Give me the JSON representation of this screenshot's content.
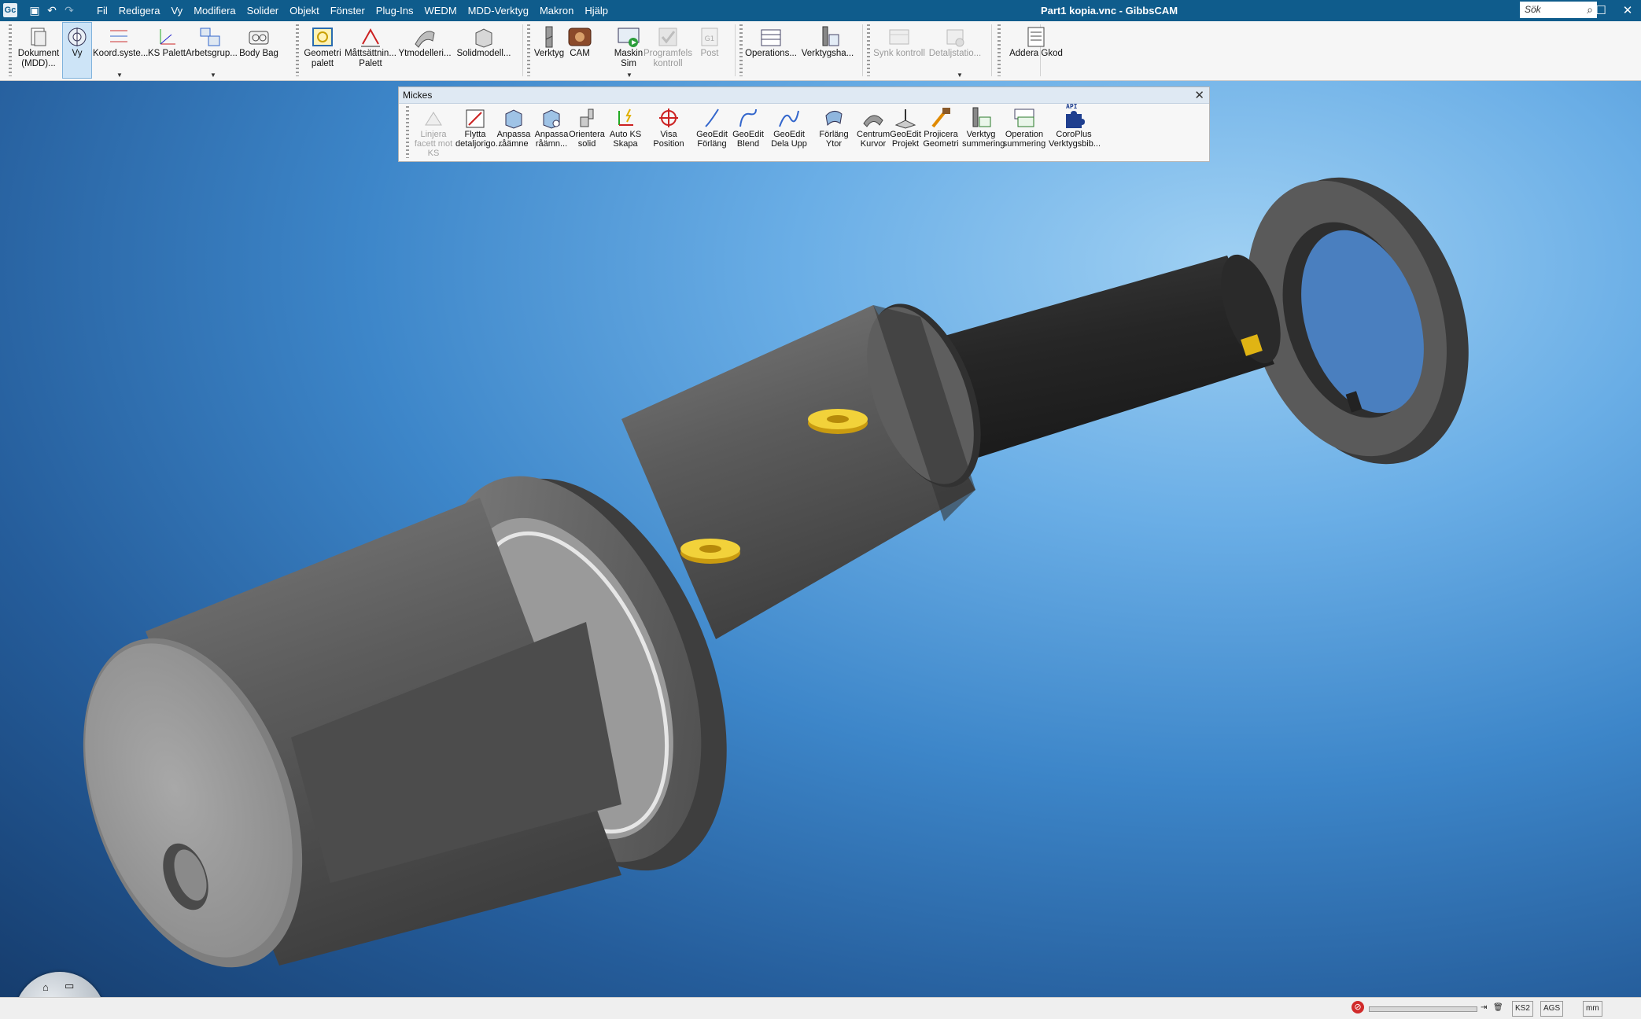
{
  "app": {
    "title": "Part1 kopia.vnc - GibbsCAM",
    "logo": "Gc",
    "search_placeholder": "Sök"
  },
  "menu": [
    "Fil",
    "Redigera",
    "Vy",
    "Modifiera",
    "Solider",
    "Objekt",
    "Fönster",
    "Plug-Ins",
    "WEDM",
    "MDD-Verktyg",
    "Makron",
    "Hjälp"
  ],
  "ribbon": {
    "buttons": [
      {
        "label": "Dokument (MDD)...",
        "icon": "document-icon",
        "state": "normal"
      },
      {
        "label": "Vy",
        "icon": "view-icon",
        "state": "selected"
      },
      {
        "label": "Koord.syste...",
        "icon": "coordinate-list-icon",
        "state": "normal"
      },
      {
        "label": "KS Palett",
        "icon": "axis-icon",
        "state": "normal"
      },
      {
        "label": "Arbetsgrup...",
        "icon": "workgroup-icon",
        "state": "normal"
      },
      {
        "label": "Body Bag",
        "icon": "body-bag-icon",
        "state": "normal"
      },
      {
        "label": "Geometri palett",
        "icon": "geometry-icon",
        "state": "normal"
      },
      {
        "label": "Måttsättnin... Palett",
        "icon": "dimension-icon",
        "state": "normal"
      },
      {
        "label": "Ytmodelleri...",
        "icon": "surface-icon",
        "state": "normal"
      },
      {
        "label": "Solidmodell...",
        "icon": "solid-icon",
        "state": "normal"
      },
      {
        "label": "Verktyg",
        "icon": "tool-icon",
        "state": "normal"
      },
      {
        "label": "CAM",
        "icon": "cam-icon",
        "state": "normal"
      },
      {
        "label": "Maskin Sim",
        "icon": "machine-sim-icon",
        "state": "normal"
      },
      {
        "label": "Programfels kontroll",
        "icon": "check-icon",
        "state": "disabled"
      },
      {
        "label": "Post",
        "icon": "post-icon",
        "state": "disabled"
      },
      {
        "label": "Operations...",
        "icon": "operations-icon",
        "state": "normal"
      },
      {
        "label": "Verktygsha...",
        "icon": "toolholder-icon",
        "state": "normal"
      },
      {
        "label": "Synk kontroll",
        "icon": "sync-icon",
        "state": "disabled"
      },
      {
        "label": "Detaljstatio...",
        "icon": "part-station-icon",
        "state": "disabled"
      },
      {
        "label": "Addera Gkod",
        "icon": "gcode-icon",
        "state": "normal"
      }
    ]
  },
  "mickes": {
    "title": "Mickes",
    "buttons": [
      {
        "label": "Linjera facett mot KS",
        "icon": "align-facet-icon",
        "state": "disabled"
      },
      {
        "label": "Flytta detaljorigo...",
        "icon": "move-origin-icon",
        "state": "normal"
      },
      {
        "label": "Anpassa råämne",
        "icon": "fit-stock-icon",
        "state": "normal"
      },
      {
        "label": "Anpassa råämn...",
        "icon": "fit-stock-view-icon",
        "state": "normal"
      },
      {
        "label": "Orientera solid",
        "icon": "orient-solid-icon",
        "state": "normal"
      },
      {
        "label": "Auto KS Skapa",
        "icon": "auto-cs-icon",
        "state": "normal"
      },
      {
        "label": "Visa Position",
        "icon": "crosshair-icon",
        "state": "normal"
      },
      {
        "label": "GeoEdit Förläng",
        "icon": "geoedit-extend-icon",
        "state": "normal"
      },
      {
        "label": "GeoEdit Blend",
        "icon": "geoedit-blend-icon",
        "state": "normal"
      },
      {
        "label": "GeoEdit Dela Upp",
        "icon": "geoedit-split-icon",
        "state": "normal"
      },
      {
        "label": "Förläng Ytor",
        "icon": "extend-surface-icon",
        "state": "normal"
      },
      {
        "label": "Centrum Kurvor",
        "icon": "center-curve-icon",
        "state": "normal"
      },
      {
        "label": "GeoEdit Projekt",
        "icon": "geoedit-project-icon",
        "state": "normal"
      },
      {
        "label": "Projicera Geometri",
        "icon": "project-geometry-icon",
        "state": "normal"
      },
      {
        "label": "Verktyg summering",
        "icon": "tool-summary-icon",
        "state": "normal"
      },
      {
        "label": "Operation summering",
        "icon": "operation-summary-icon",
        "state": "normal"
      },
      {
        "label": "CoroPlus Verktygsbib...",
        "icon": "api-puzzle-icon",
        "state": "normal",
        "badge": "API"
      }
    ]
  },
  "status": {
    "cs": "KS2",
    "view": "AGS",
    "unit": "mm"
  },
  "colors": {
    "titlebar": "#0f5c8c",
    "viewport_top": "#9fd0f3",
    "viewport_bottom": "#163d6e",
    "part": "#5a5a5a",
    "screw": "#e8c21a"
  }
}
